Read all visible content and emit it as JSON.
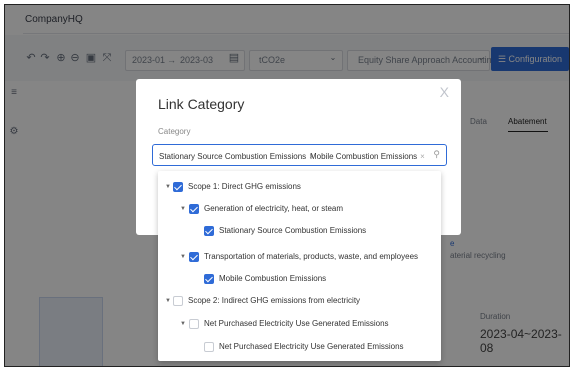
{
  "app": {
    "company": "CompanyHQ"
  },
  "toolbar": {
    "date_start": "2023-01",
    "date_sep": "→",
    "date_end": "2023-03",
    "unit": "tCO2e",
    "approach": "Equity Share Approach Accounting",
    "config_label": "Configuration",
    "config_icon": "list-config-icon"
  },
  "background": {
    "tab_data": "Data",
    "tab_abatement": "Abatement",
    "tag_fragment": "e",
    "row_text": "aterial recycling",
    "duration_label": "Duration",
    "duration_value": "2023-04~2023-08"
  },
  "modal": {
    "title": "Link Category",
    "close": "X",
    "field_label": "Category",
    "selected_tags": [
      "Stationary Source Combustion Emissions",
      "Mobile Combustion Emissions"
    ],
    "tag_remove": "×"
  },
  "tree": [
    {
      "label": "Scope 1: Direct GHG emissions",
      "level": 0,
      "checked": true,
      "expanded": true
    },
    {
      "label": "Generation of electricity, heat, or steam",
      "level": 1,
      "checked": true,
      "expanded": true
    },
    {
      "label": "Stationary Source Combustion Emissions",
      "level": 2,
      "checked": true,
      "expanded": false
    },
    {
      "label": "Transportation of materials, products, waste, and employees",
      "level": 1,
      "checked": true,
      "expanded": true
    },
    {
      "label": "Mobile Combustion Emissions",
      "level": 2,
      "checked": true,
      "expanded": false
    },
    {
      "label": "Scope 2: Indirect GHG emissions from electricity",
      "level": 0,
      "checked": false,
      "expanded": true
    },
    {
      "label": "Net Purchased Electricity Use Generated Emissions",
      "level": 1,
      "checked": false,
      "expanded": true
    },
    {
      "label": "Net Purchased Electricity Use Generated Emissions",
      "level": 2,
      "checked": false,
      "expanded": false
    }
  ],
  "colors": {
    "primary": "#2f6bd7",
    "overlay": "rgba(0,0,0,0.48)"
  }
}
